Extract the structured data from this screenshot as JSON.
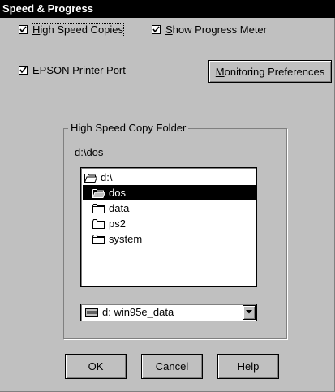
{
  "window": {
    "title": "Speed & Progress"
  },
  "options": {
    "high_speed_copies": {
      "label_first": "H",
      "label_rest": "igh Speed Copies",
      "checked": true
    },
    "show_progress_meter": {
      "label_first": "S",
      "label_rest": "how Progress Meter",
      "checked": true
    },
    "epson_printer_port": {
      "label_first": "E",
      "label_rest": "PSON Printer Port",
      "checked": true
    }
  },
  "buttons": {
    "monitoring_first": "M",
    "monitoring_rest": "onitoring Preferences",
    "ok": "OK",
    "cancel": "Cancel",
    "help": "Help"
  },
  "folder_group": {
    "title": "High Speed Copy Folder",
    "current_path": "d:\\dos",
    "tree": [
      {
        "label": "d:\\",
        "icon": "folder-open-icon",
        "level": 0,
        "selected": false
      },
      {
        "label": "dos",
        "icon": "folder-open-icon",
        "level": 1,
        "selected": true
      },
      {
        "label": "data",
        "icon": "folder-icon",
        "level": 1,
        "selected": false
      },
      {
        "label": "ps2",
        "icon": "folder-icon",
        "level": 1,
        "selected": false
      },
      {
        "label": "system",
        "icon": "folder-icon",
        "level": 1,
        "selected": false
      }
    ],
    "drive_select": {
      "value": "d:  win95e_data",
      "icon": "drive-icon"
    }
  },
  "colors": {
    "dialog_bg": "#c0c0c0",
    "title_bg": "#000000",
    "selection_bg": "#000000"
  }
}
